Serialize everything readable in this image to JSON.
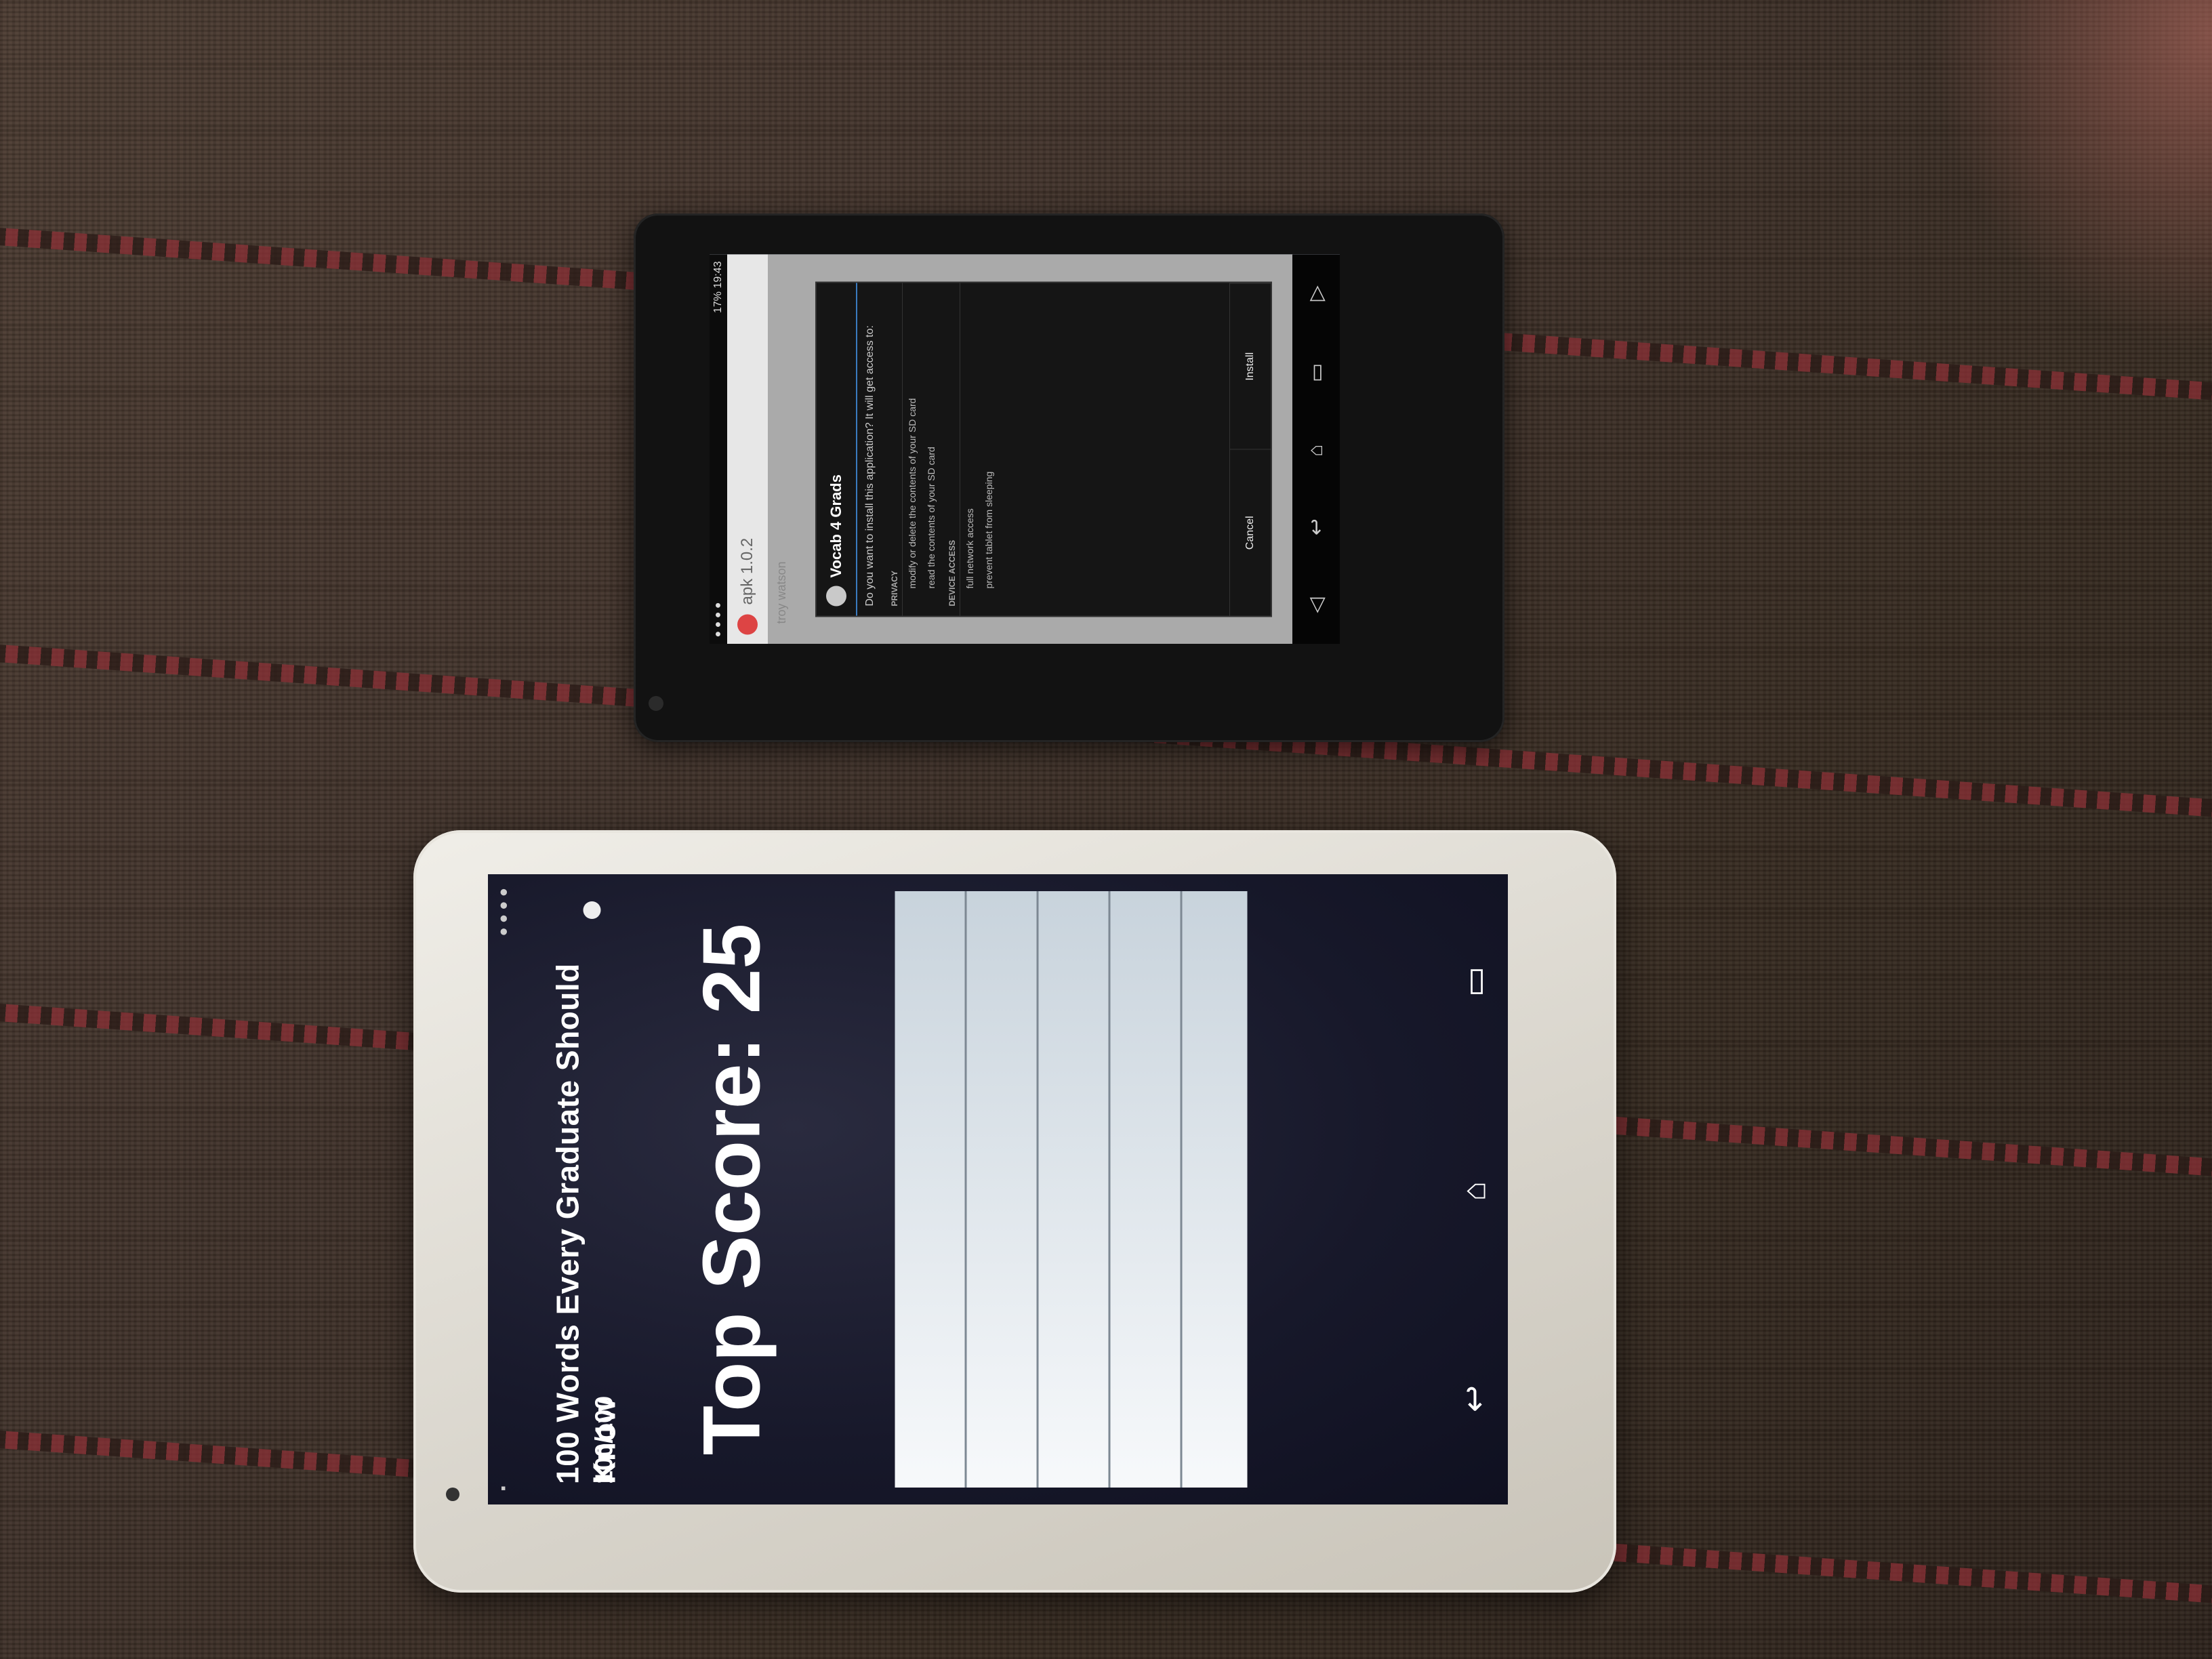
{
  "small_tablet": {
    "status_time": "19:43",
    "status_battery": "17%",
    "app_title": "apk 1.0.2",
    "user": "troy watson",
    "dialog": {
      "app_name": "Vocab 4 Grads",
      "question": "Do you want to install this application? It will get access to:",
      "privacy_section": "PRIVACY",
      "perm_modify": "modify or delete the contents of your SD card",
      "perm_read": "read the contents of your SD card",
      "device_section": "DEVICE ACCESS",
      "perm_network": "full network access",
      "perm_sleep": "prevent tablet from sleeping",
      "cancel": "Cancel",
      "install": "Install"
    },
    "nav_icons": [
      "volume-icon",
      "back-icon",
      "home-icon",
      "recent-apps-icon",
      "volume-up-icon"
    ]
  },
  "white_tablet": {
    "title": "100 Words Every Graduate Should Know",
    "progress": "100/100",
    "top_score": "Top Score: 25",
    "list_rows": 5,
    "nav_icons": [
      "back-icon",
      "home-icon",
      "recent-apps-icon"
    ]
  },
  "colors": {
    "fabric": "#3e3028",
    "stripe": "#8a2f35",
    "white_tablet_screen": "#17182a",
    "list_panel": "#f7f9fb"
  }
}
